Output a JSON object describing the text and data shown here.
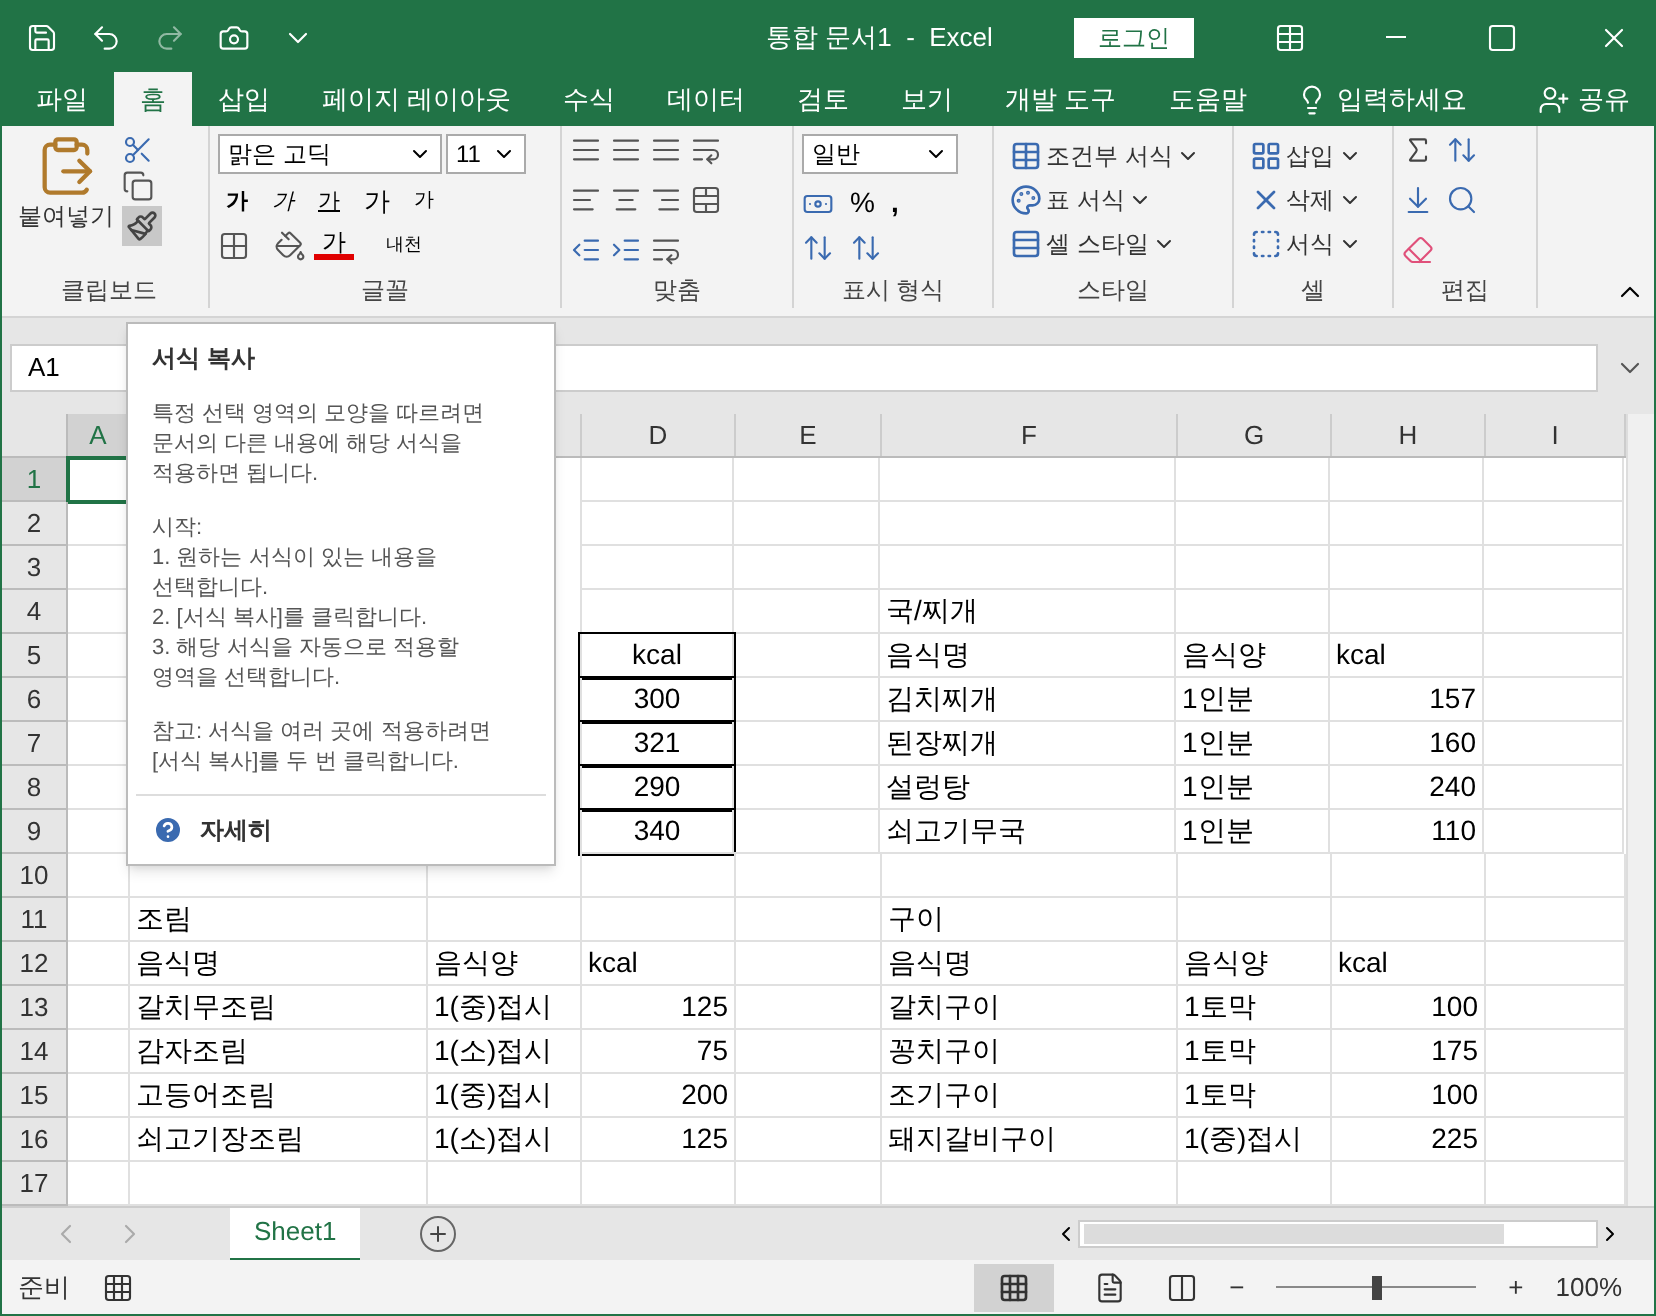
{
  "window": {
    "title": "통합 문서1  -  Excel",
    "login": "로그인"
  },
  "tabs": [
    {
      "label": "파일",
      "selected": false
    },
    {
      "label": "홈",
      "selected": true
    },
    {
      "label": "삽입",
      "selected": false
    },
    {
      "label": "페이지 레이아웃",
      "selected": false
    },
    {
      "label": "수식",
      "selected": false
    },
    {
      "label": "데이터",
      "selected": false
    },
    {
      "label": "검토",
      "selected": false
    },
    {
      "label": "보기",
      "selected": false
    },
    {
      "label": "개발 도구",
      "selected": false
    },
    {
      "label": "도움말",
      "selected": false
    }
  ],
  "tell_me": "입력하세요",
  "share": "공유",
  "ribbon": {
    "groups": [
      {
        "kind": "clipboard",
        "label": "클립보드",
        "paste": "붙여넣기"
      },
      {
        "kind": "font",
        "label": "글꼴",
        "font_name": "맑은 고딕",
        "font_size": "11",
        "bold": "가",
        "italic": "가",
        "underline": "가",
        "grow": "가",
        "shrink": "가",
        "font_color": "가",
        "phonetic": "내천"
      },
      {
        "kind": "alignment",
        "label": "맞춤"
      },
      {
        "kind": "number",
        "label": "표시 형식",
        "format": "일반",
        "percent": "%",
        "comma": ","
      },
      {
        "kind": "styles",
        "label": "스타일",
        "items": [
          "조건부 서식",
          "표 서식",
          "셀 스타일"
        ]
      },
      {
        "kind": "cells",
        "label": "셀",
        "items": [
          "삽입",
          "삭제",
          "서식"
        ]
      },
      {
        "kind": "editing",
        "label": "편집"
      }
    ]
  },
  "name_box": "A1",
  "columns": [
    "A",
    "D",
    "E",
    "F",
    "G",
    "H",
    "I"
  ],
  "rows": [
    {
      "header": "1"
    },
    {
      "header": "2"
    },
    {
      "header": "3"
    },
    {
      "header": "4",
      "cells": {
        "F": {
          "text": "국/찌개"
        }
      }
    },
    {
      "header": "5",
      "cells": {
        "D": {
          "text": "kcal",
          "boxed": true
        },
        "F": {
          "text": "음식명"
        },
        "G": {
          "text": "음식양"
        },
        "H": {
          "text": "kcal"
        }
      }
    },
    {
      "header": "6",
      "cells": {
        "D": {
          "text": "300",
          "boxed": true
        },
        "F": {
          "text": "김치찌개"
        },
        "G": {
          "text": "1인분"
        },
        "H": {
          "text": "157",
          "kind": "number"
        }
      }
    },
    {
      "header": "7",
      "cells": {
        "D": {
          "text": "321",
          "boxed": true
        },
        "F": {
          "text": "된장찌개"
        },
        "G": {
          "text": "1인분"
        },
        "H": {
          "text": "160",
          "kind": "number"
        }
      }
    },
    {
      "header": "8",
      "cells": {
        "D": {
          "text": "290",
          "boxed": true
        },
        "F": {
          "text": "설렁탕"
        },
        "G": {
          "text": "1인분"
        },
        "H": {
          "text": "240",
          "kind": "number"
        }
      }
    },
    {
      "header": "9",
      "cells": {
        "D": {
          "text": "340",
          "boxed": true
        },
        "F": {
          "text": "쇠고기무국"
        },
        "G": {
          "text": "1인분"
        },
        "H": {
          "text": "110",
          "kind": "number"
        }
      }
    },
    {
      "header": "10"
    },
    {
      "header": "11",
      "cells": {
        "B": {
          "text": "조림"
        },
        "F": {
          "text": "구이"
        }
      }
    },
    {
      "header": "12",
      "cells": {
        "B": {
          "text": "음식명"
        },
        "C": {
          "text": "음식양"
        },
        "D": {
          "text": "kcal"
        },
        "F": {
          "text": "음식명"
        },
        "G": {
          "text": "음식양"
        },
        "H": {
          "text": "kcal"
        }
      }
    },
    {
      "header": "13",
      "cells": {
        "B": {
          "text": "갈치무조림"
        },
        "C": {
          "text": "1(중)접시"
        },
        "D": {
          "text": "125",
          "kind": "number"
        },
        "F": {
          "text": "갈치구이"
        },
        "G": {
          "text": "1토막"
        },
        "H": {
          "text": "100",
          "kind": "number"
        }
      }
    },
    {
      "header": "14",
      "cells": {
        "B": {
          "text": "감자조림"
        },
        "C": {
          "text": "1(소)접시"
        },
        "D": {
          "text": "75",
          "kind": "number"
        },
        "F": {
          "text": "꽁치구이"
        },
        "G": {
          "text": "1토막"
        },
        "H": {
          "text": "175",
          "kind": "number"
        }
      }
    },
    {
      "header": "15",
      "cells": {
        "B": {
          "text": "고등어조림"
        },
        "C": {
          "text": "1(중)접시"
        },
        "D": {
          "text": "200",
          "kind": "number"
        },
        "F": {
          "text": "조기구이"
        },
        "G": {
          "text": "1토막"
        },
        "H": {
          "text": "100",
          "kind": "number"
        }
      }
    },
    {
      "header": "16",
      "cells": {
        "B": {
          "text": "쇠고기장조림"
        },
        "C": {
          "text": "1(소)접시"
        },
        "D": {
          "text": "125",
          "kind": "number"
        },
        "F": {
          "text": "돼지갈비구이"
        },
        "G": {
          "text": "1(중)접시"
        },
        "H": {
          "text": "225",
          "kind": "number"
        }
      }
    },
    {
      "header": "17"
    }
  ],
  "tooltip": {
    "title": "서식 복사",
    "paragraphs": [
      "특정 선택 영역의 모양을 따르려면\n문서의 다른 내용에 해당 서식을\n적용하면 됩니다.",
      "시작:\n1. 원하는 서식이 있는 내용을\n선택합니다.\n2. [서식 복사]를 클릭합니다.\n3. 해당 서식을 자동으로 적용할\n영역을 선택합니다.",
      "참고: 서식을 여러 곳에 적용하려면\n[서식 복사]를 두 번 클릭합니다."
    ],
    "link": "자세히"
  },
  "sheets": [
    {
      "label": "Sheet1",
      "selected": true
    }
  ],
  "status": {
    "text": "준비",
    "zoom_out": "−",
    "zoom_in": "+",
    "zoom": "100%",
    "zoom_slider": {
      "level": 0.5
    }
  }
}
